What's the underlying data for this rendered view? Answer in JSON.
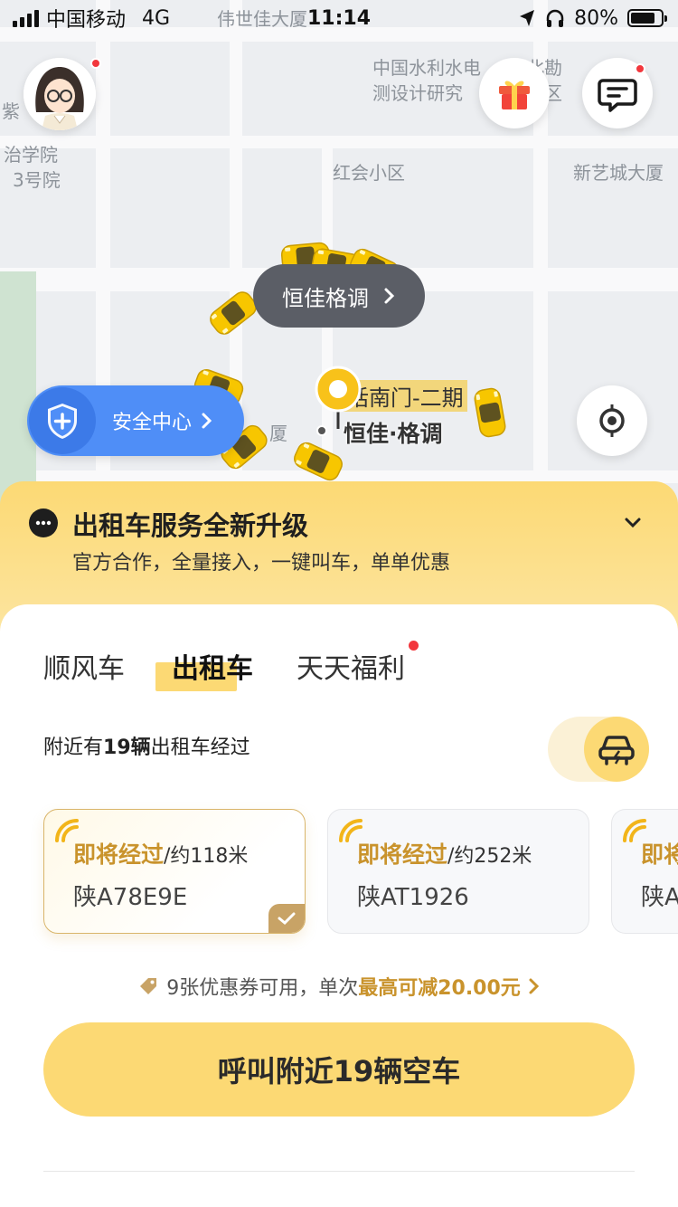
{
  "status_bar": {
    "carrier": "中国移动",
    "network": "4G",
    "time": "11:14",
    "battery_percent": "80%",
    "battery_level": 0.8
  },
  "map": {
    "labels": [
      "伟世佳大厦",
      "中国水利水电",
      "北勘",
      "测设计研究",
      "区",
      "紫",
      "治学院",
      "3号院",
      "红会小区",
      "新艺城大厦",
      "厦"
    ],
    "pickup_bubble": "恒佳格调",
    "poi_primary": "话南门-二期",
    "poi_location": "恒佳·格调",
    "safety_center": "安全中心"
  },
  "promo": {
    "title": "出租车服务全新升级",
    "subtitle": "官方合作，全量接入，一键叫车，单单优惠"
  },
  "tabs": [
    {
      "label": "顺风车",
      "active": false
    },
    {
      "label": "出租车",
      "active": true
    },
    {
      "label": "天天福利",
      "active": false,
      "badge": true
    }
  ],
  "nearby": {
    "prefix": "附近有",
    "count": "19辆",
    "suffix": "出租车经过"
  },
  "cars": [
    {
      "eta": "即将经过",
      "distance": "/约118米",
      "plate": "陕A78E9E",
      "selected": true
    },
    {
      "eta": "即将经过",
      "distance": "/约252米",
      "plate": "陕AT1926",
      "selected": false
    },
    {
      "eta": "即将",
      "distance": "",
      "plate": "陕A",
      "selected": false
    }
  ],
  "coupon": {
    "text": "9张优惠券可用，单次",
    "highlight": "最高可减20.00元"
  },
  "call_button": "呼叫附近19辆空车",
  "colors": {
    "brand_yellow": "#fcd974",
    "accent_gold": "#c9932c",
    "safety_blue": "#4f8ef7",
    "badge_red": "#f2373d"
  }
}
